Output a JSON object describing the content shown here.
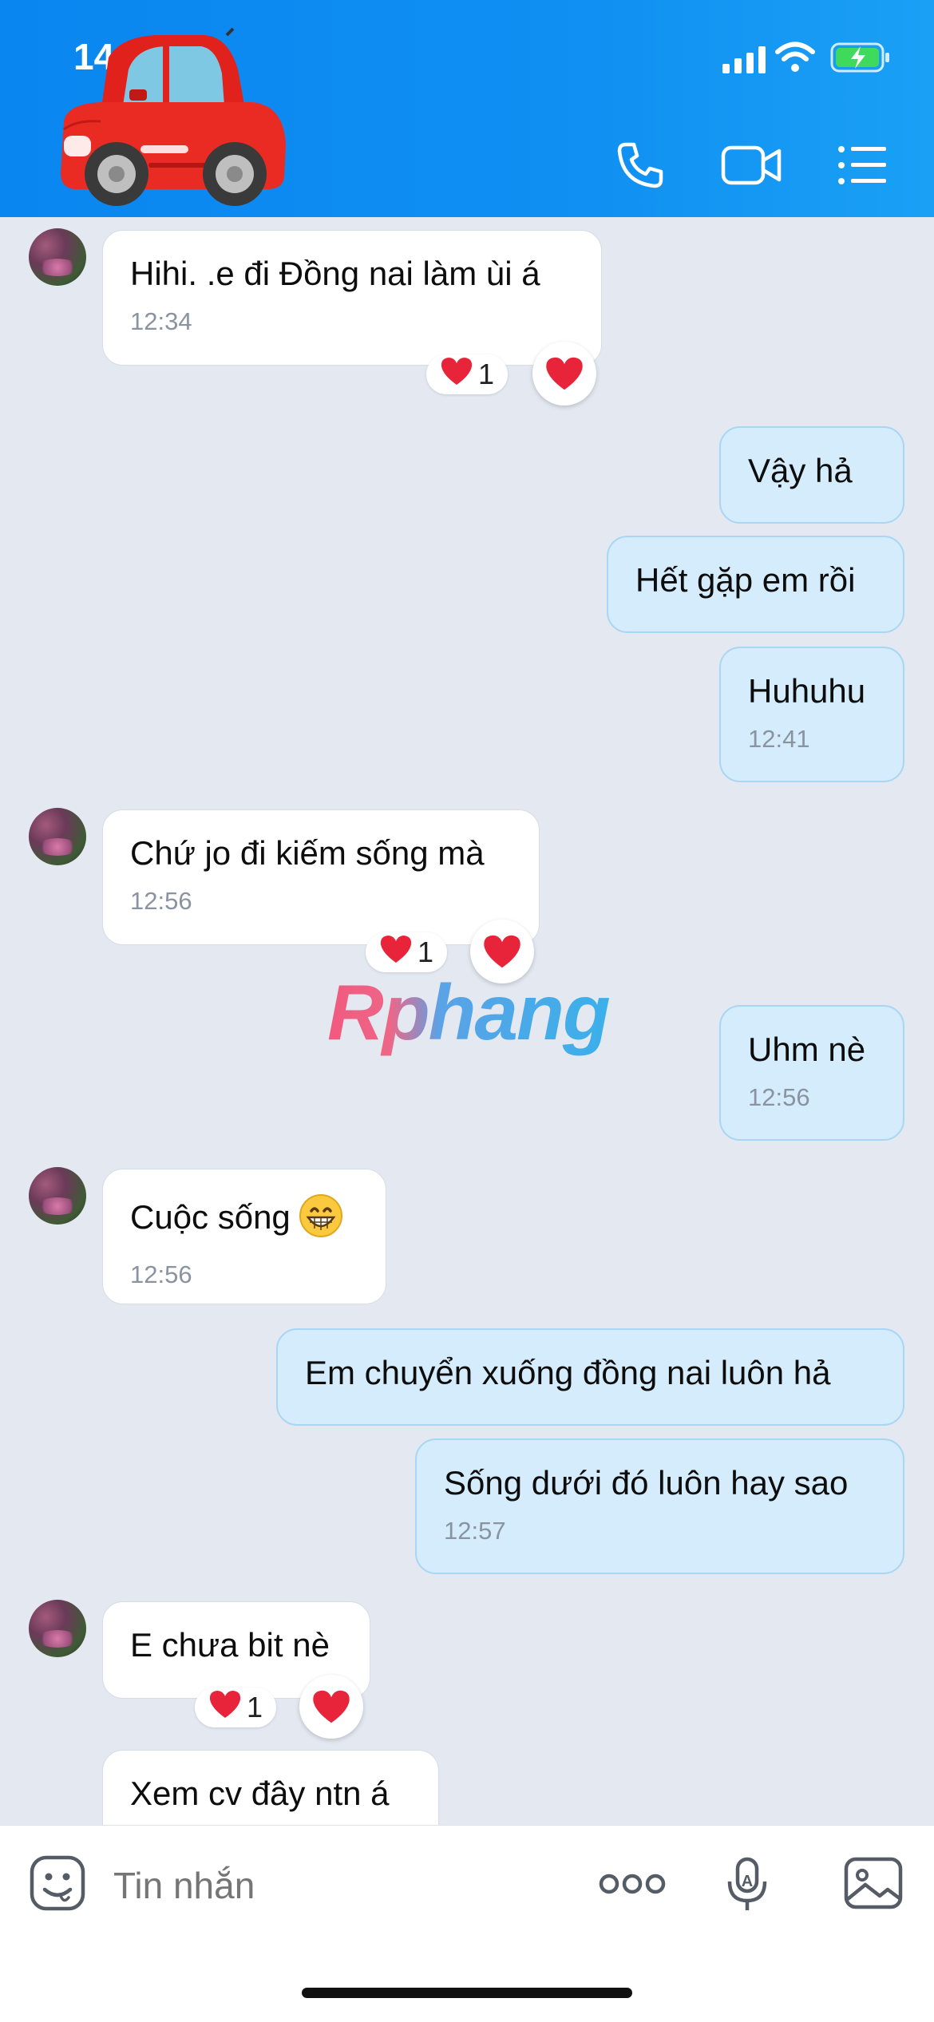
{
  "status_bar": {
    "time": "14:0"
  },
  "header": {
    "avatar_icon": "car-emoji-icon",
    "call_icon": "phone-icon",
    "video_icon": "video-camera-icon",
    "menu_icon": "list-menu-icon",
    "bg_color": "#0a86f0"
  },
  "messages": [
    {
      "dir": "in",
      "text": "Hihi. .e đi Đồng nai làm ùi á",
      "time": "12:34",
      "reaction": "❤️",
      "reaction_count": "1"
    },
    {
      "dir": "out",
      "text": "Vậy hả"
    },
    {
      "dir": "out",
      "text": "Hết gặp em rồi"
    },
    {
      "dir": "out",
      "text": "Huhuhu",
      "time": "12:41"
    },
    {
      "dir": "in",
      "text": "Chứ jo đi kiếm sống mà",
      "time": "12:56",
      "reaction": "❤️",
      "reaction_count": "1"
    },
    {
      "dir": "out",
      "text": "Uhm nè",
      "time": "12:56"
    },
    {
      "dir": "in",
      "text": "Cuộc sống",
      "emoji": "grinning-face-icon",
      "time": "12:56"
    },
    {
      "dir": "out",
      "text": "Em chuyển xuống đồng nai luôn hả"
    },
    {
      "dir": "out",
      "text": "Sống dưới đó luôn hay sao",
      "time": "12:57"
    },
    {
      "dir": "in",
      "text": "E chưa bit nè",
      "reaction": "❤️",
      "reaction_count": "1"
    },
    {
      "dir": "in",
      "text": "Xem cv đây ntn á"
    }
  ],
  "watermark": "Rphang",
  "input": {
    "placeholder": "Tin nhắn",
    "sticker_icon": "sticker-face-icon",
    "more_icon": "more-dots-icon",
    "voice_icon": "microphone-icon",
    "image_icon": "image-icon"
  },
  "colors": {
    "outgoing_bubble": "#d4ecfb",
    "incoming_bubble": "#ffffff",
    "chat_bg": "#e3e8f1",
    "heart": "#e8243a"
  }
}
